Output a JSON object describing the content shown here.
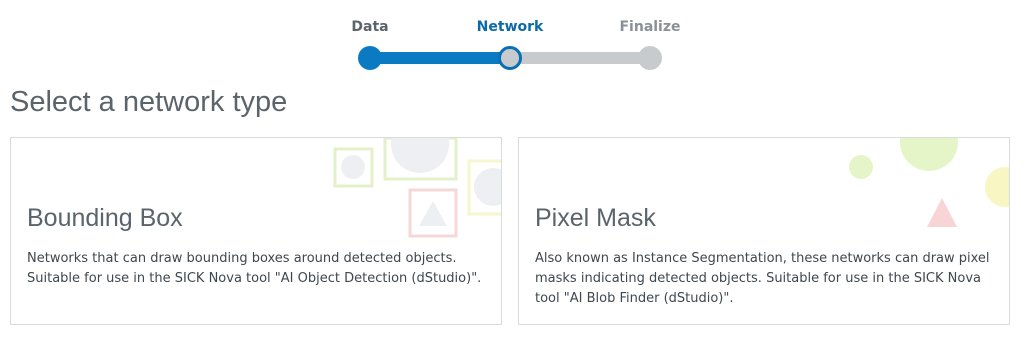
{
  "stepper": {
    "steps": [
      {
        "label": "Data",
        "state": "done"
      },
      {
        "label": "Network",
        "state": "active"
      },
      {
        "label": "Finalize",
        "state": "todo"
      }
    ],
    "colors": {
      "filled": "#0a7bc2",
      "empty": "#c8cbce",
      "active_label": "#0b6aa7"
    }
  },
  "main": {
    "title": "Select a network type",
    "cards": [
      {
        "title": "Bounding Box",
        "description": "Networks that can draw bounding boxes around detected objects. Suitable for use in the SICK Nova tool \"AI Object Detection (dStudio)\"."
      },
      {
        "title": "Pixel Mask",
        "description": "Also known as Instance Segmentation, these networks can draw pixel masks indicating detected objects. Suitable for use in the SICK Nova tool \"AI Blob Finder (dStudio)\"."
      }
    ]
  }
}
